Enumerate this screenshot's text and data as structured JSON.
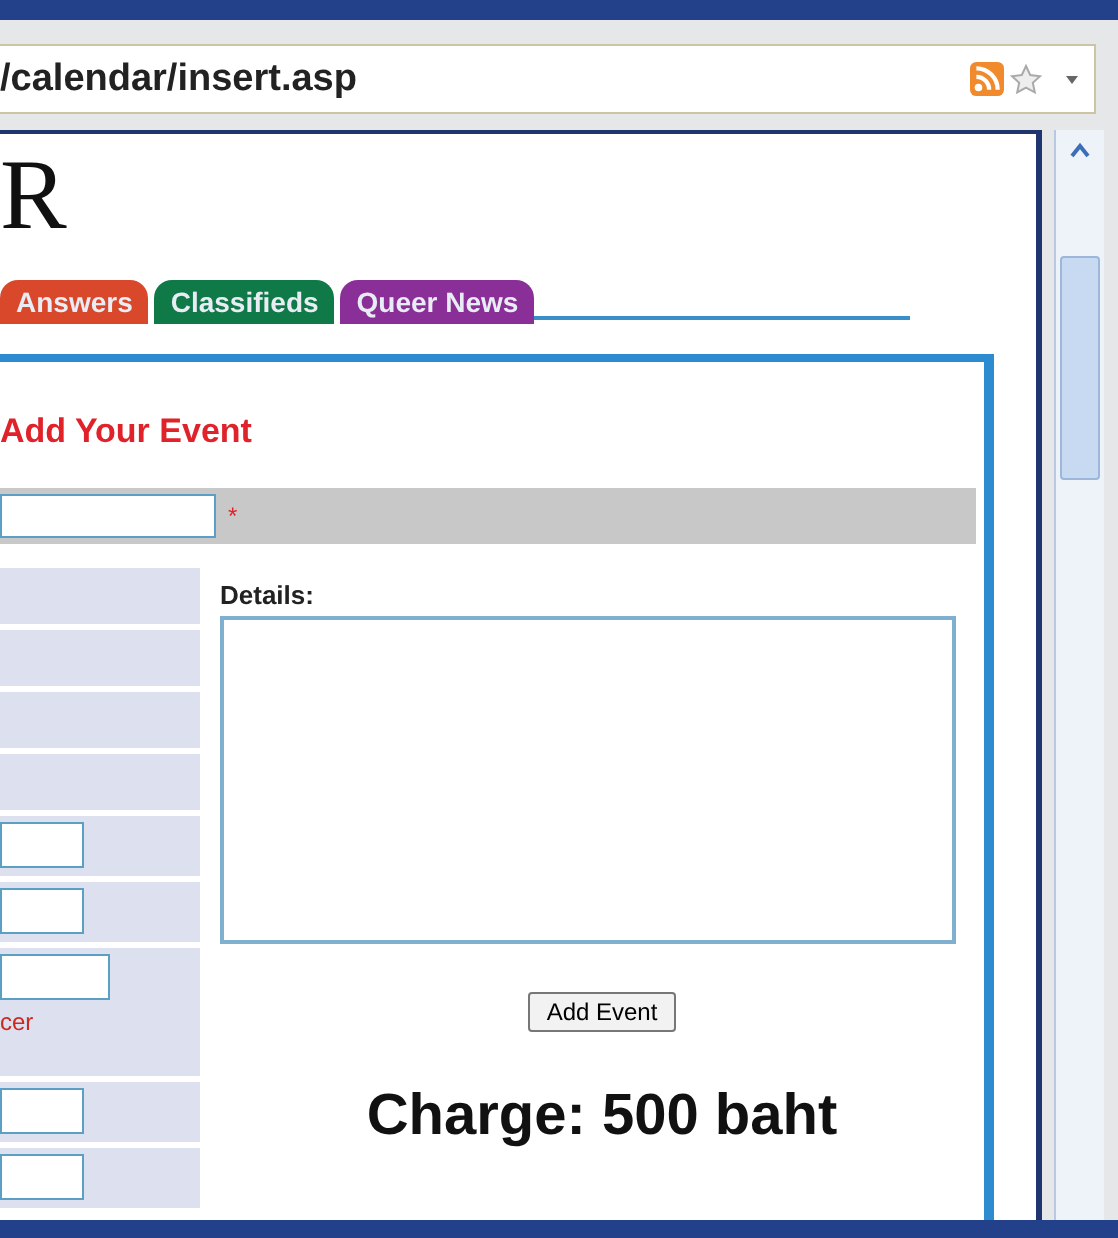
{
  "browser": {
    "address": "/calendar/insert.asp"
  },
  "page": {
    "logo": "R",
    "tabs": [
      {
        "label": "Answers",
        "color": "#d9482b",
        "selected": false
      },
      {
        "label": "Classifieds",
        "color": "#0f7a47",
        "selected": false
      },
      {
        "label": "Queer News",
        "color": "#8b2f98",
        "selected": false
      }
    ],
    "form": {
      "heading": "Add Your Event",
      "required_mark": "*",
      "rows": [
        {
          "kind": "empty"
        },
        {
          "kind": "empty"
        },
        {
          "kind": "empty"
        },
        {
          "kind": "empty"
        },
        {
          "kind": "input"
        },
        {
          "kind": "input"
        },
        {
          "kind": "input-note",
          "note": "cer"
        },
        {
          "kind": "input"
        },
        {
          "kind": "input"
        }
      ],
      "details_label": "Details:",
      "submit": "Add Event",
      "charge": "Charge: 500 baht"
    }
  }
}
